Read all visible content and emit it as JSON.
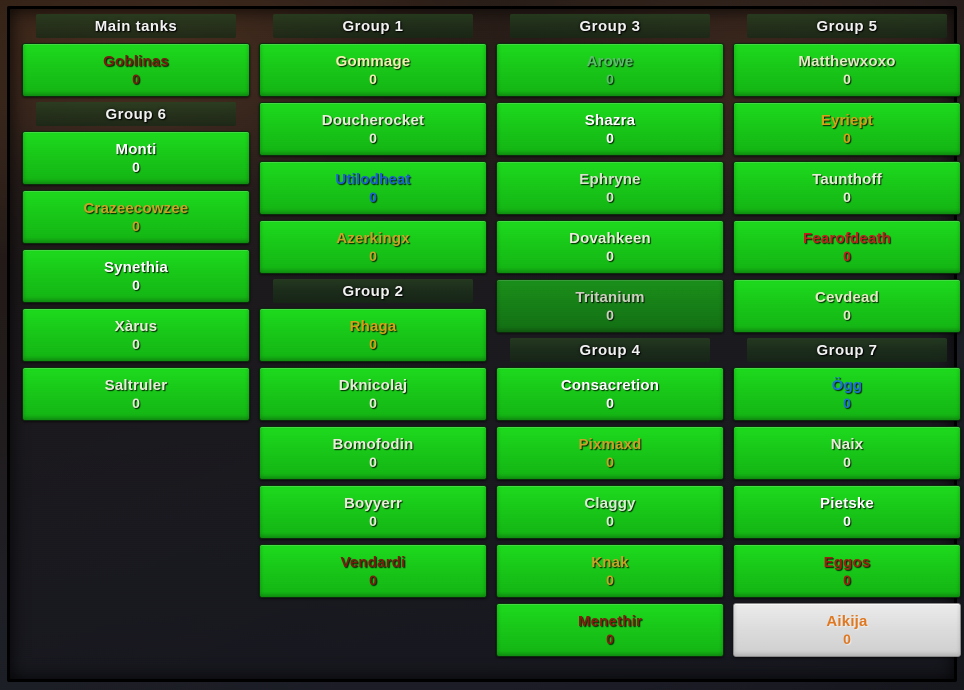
{
  "window": {
    "title": "Raid Group Frames",
    "background_color": "#221a18",
    "frame_border_color": "#000000"
  },
  "colors": {
    "bar_green": "#18c818",
    "bar_green_dim": "#169016",
    "bar_selected": "#dcdcdc",
    "header_text": "#f2f2f2",
    "class_white": "#ffffff",
    "class_paleyellow": "#f5f0a8",
    "class_yellow": "#e8c41a",
    "class_gold": "#d4a017",
    "class_blue": "#1d5fd6",
    "class_lightblue": "#3fc7f0",
    "class_red": "#c41e1e",
    "class_darkred": "#7a1c10",
    "class_hunter_green": "#5bbf6a",
    "class_orange": "#e07820",
    "class_pale": "#e4e8c8",
    "class_tan": "#c9b98a"
  },
  "columns": [
    {
      "id": "column-1",
      "blocks": [
        {
          "type": "group",
          "header": "Main tanks",
          "members": [
            {
              "name": "Goblinas",
              "value": "0",
              "color": "#7a1c10",
              "state": "normal"
            }
          ]
        },
        {
          "type": "group",
          "header": "Group 6",
          "members": [
            {
              "name": "Monti",
              "value": "0",
              "color": "#ffffff",
              "state": "normal"
            },
            {
              "name": "Crazeecowzee",
              "value": "0",
              "color": "#c9a227",
              "state": "normal"
            },
            {
              "name": "Synethia",
              "value": "0",
              "color": "#ffffff",
              "state": "normal"
            },
            {
              "name": "Xàrus",
              "value": "0",
              "color": "#e8edd8",
              "state": "normal"
            },
            {
              "name": "Saltruler",
              "value": "0",
              "color": "#e8edd8",
              "state": "normal"
            }
          ]
        }
      ]
    },
    {
      "id": "column-2",
      "blocks": [
        {
          "type": "group",
          "header": "Group 1",
          "members": [
            {
              "name": "Gommage",
              "value": "0",
              "color": "#f2efb0",
              "state": "normal"
            },
            {
              "name": "Doucherocket",
              "value": "0",
              "color": "#e8edd8",
              "state": "normal"
            },
            {
              "name": "Utilodheat",
              "value": "0",
              "color": "#1d5fd6",
              "state": "normal"
            },
            {
              "name": "Azerkingx",
              "value": "0",
              "color": "#c9a227",
              "state": "normal"
            }
          ]
        },
        {
          "type": "group",
          "header": "Group 2",
          "members": [
            {
              "name": "Rhaga",
              "value": "0",
              "color": "#d4a017",
              "state": "normal"
            },
            {
              "name": "Dknicolaj",
              "value": "0",
              "color": "#e8edd8",
              "state": "normal"
            },
            {
              "name": "Bomofodin",
              "value": "0",
              "color": "#e8edd8",
              "state": "normal"
            },
            {
              "name": "Boyyerr",
              "value": "0",
              "color": "#e8edd8",
              "state": "normal"
            },
            {
              "name": "Vendardi",
              "value": "0",
              "color": "#7a1c10",
              "state": "normal"
            }
          ]
        }
      ]
    },
    {
      "id": "column-3",
      "blocks": [
        {
          "type": "group",
          "header": "Group 3",
          "members": [
            {
              "name": "Arowe",
              "value": "0",
              "color": "#5bbf6a",
              "state": "normal"
            },
            {
              "name": "Shazra",
              "value": "0",
              "color": "#ffffff",
              "state": "normal"
            },
            {
              "name": "Ephryne",
              "value": "0",
              "color": "#d8e4cc",
              "state": "normal"
            },
            {
              "name": "Dovahkeen",
              "value": "0",
              "color": "#e8edd8",
              "state": "normal"
            },
            {
              "name": "Tritanium",
              "value": "0",
              "color": "#e8edd8",
              "state": "dim"
            }
          ]
        },
        {
          "type": "group",
          "header": "Group 4",
          "members": [
            {
              "name": "Consacretion",
              "value": "0",
              "color": "#ffffff",
              "state": "normal"
            },
            {
              "name": "Pixmaxd",
              "value": "0",
              "color": "#c9a227",
              "state": "normal"
            },
            {
              "name": "Claggy",
              "value": "0",
              "color": "#d8f0d0",
              "state": "normal"
            },
            {
              "name": "Knak",
              "value": "0",
              "color": "#c9a227",
              "state": "normal"
            },
            {
              "name": "Menethir",
              "value": "0",
              "color": "#8a1b10",
              "state": "normal"
            }
          ]
        }
      ]
    },
    {
      "id": "column-4",
      "blocks": [
        {
          "type": "group",
          "header": "Group 5",
          "members": [
            {
              "name": "Matthewxoxo",
              "value": "0",
              "color": "#e4eac4",
              "state": "normal"
            },
            {
              "name": "Eyriept",
              "value": "0",
              "color": "#d4a017",
              "state": "normal"
            },
            {
              "name": "Taunthoff",
              "value": "0",
              "color": "#e8edd8",
              "state": "normal"
            },
            {
              "name": "Fearofdeath",
              "value": "0",
              "color": "#c41e1e",
              "state": "normal"
            },
            {
              "name": "Cevdead",
              "value": "0",
              "color": "#e4eac4",
              "state": "normal"
            }
          ]
        },
        {
          "type": "group",
          "header": "Group 7",
          "members": [
            {
              "name": "Ögg",
              "value": "0",
              "color": "#1d6fd6",
              "state": "normal"
            },
            {
              "name": "Naix",
              "value": "0",
              "color": "#e8edd8",
              "state": "normal"
            },
            {
              "name": "Pietske",
              "value": "0",
              "color": "#ffffff",
              "state": "normal"
            },
            {
              "name": "Eggos",
              "value": "0",
              "color": "#9c2010",
              "state": "normal"
            },
            {
              "name": "Aikija",
              "value": "0",
              "color": "#e07820",
              "state": "selected"
            }
          ]
        }
      ]
    }
  ]
}
